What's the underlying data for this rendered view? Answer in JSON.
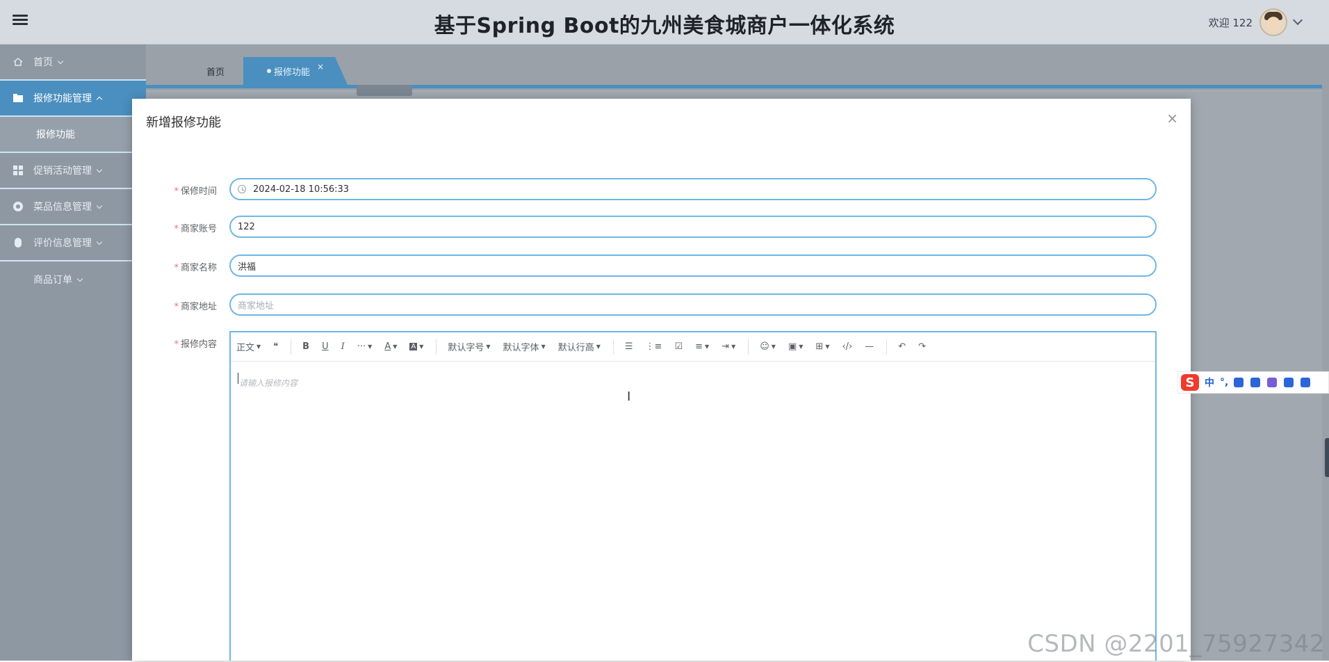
{
  "header": {
    "title": "基于Spring Boot的九州美食城商户一体化系统",
    "welcome": "欢迎 122"
  },
  "sidebar": {
    "items": [
      {
        "label": "首页",
        "icon": "home-icon"
      },
      {
        "label": "报修功能管理",
        "icon": "folder-icon",
        "active": true
      },
      {
        "label": "报修功能",
        "sub": true
      },
      {
        "label": "促销活动管理",
        "icon": "grid-icon"
      },
      {
        "label": "菜品信息管理",
        "icon": "dish-icon"
      },
      {
        "label": "评价信息管理",
        "icon": "comment-icon"
      },
      {
        "label": "商品订单"
      }
    ]
  },
  "tabs": [
    {
      "label": "首页"
    },
    {
      "label": "报修功能",
      "active": true,
      "close": "×"
    }
  ],
  "modal": {
    "title": "新增报修功能",
    "close": "×",
    "fields": [
      {
        "label": "保修时间",
        "value": "2024-02-18 10:56:33",
        "icon": "clock-icon"
      },
      {
        "label": "商家账号",
        "value": "122"
      },
      {
        "label": "商家名称",
        "value": "洪福"
      },
      {
        "label": "商家地址",
        "placeholder": "商家地址"
      }
    ],
    "editor": {
      "label": "报修内容",
      "placeholder": "请输入报修内容",
      "toolbar": {
        "heading": "正文",
        "quote": "❝",
        "bold": "B",
        "underline": "U",
        "italic": "I",
        "more": "···",
        "font_color": "A",
        "bg_color": "A",
        "font_size": "默认字号",
        "font_family": "默认字体",
        "line_height": "默认行高",
        "bullet_list": "☰",
        "numbered_list": "⋮≡",
        "todo": "☑",
        "align": "≡",
        "indent": "⇥",
        "emoji": "☺",
        "image": "▣",
        "table": "⊞",
        "code": "‹/›",
        "divider": "—",
        "undo": "↶",
        "redo": "↷"
      }
    }
  },
  "ime": {
    "logo": "S",
    "mode": "中",
    "punct": "°,"
  },
  "watermark": "CSDN @2201_75927342",
  "colors": {
    "accent": "#4a8fbf",
    "input_border": "#6fb6e6",
    "required": "#f56c6c"
  }
}
